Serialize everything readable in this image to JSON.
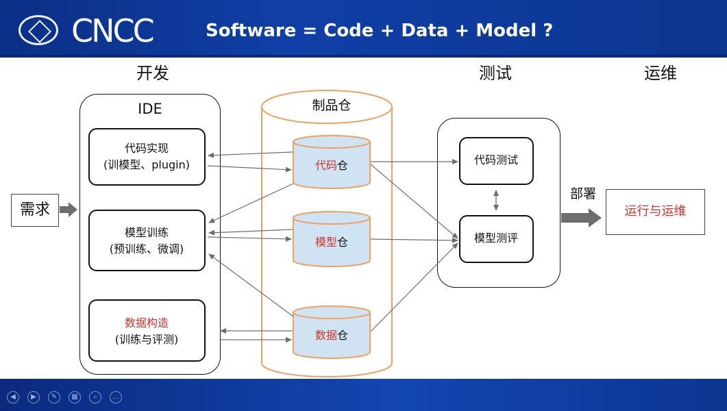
{
  "header": {
    "logo_text": "CNCC",
    "title": "Software = Code + Data + Model ?"
  },
  "stages": {
    "dev": "开发",
    "test": "测试",
    "ops": "运维"
  },
  "ide": {
    "title": "IDE",
    "code_impl": {
      "line1": "代码实现",
      "line2": "(训模型、plugin)"
    },
    "model_train": {
      "line1": "模型训练",
      "line2": "(预训练、微调)"
    },
    "data_build": {
      "line1": "数据构造",
      "line2": "(训练与评测)"
    }
  },
  "repo": {
    "title": "制品仓",
    "code": {
      "highlight": "代码",
      "suffix": "仓"
    },
    "model": {
      "highlight": "模型",
      "suffix": "仓"
    },
    "data": {
      "highlight": "数据",
      "suffix": "仓"
    }
  },
  "testing": {
    "code_test": "代码测试",
    "model_eval": "模型测评"
  },
  "requirement": "需求",
  "deploy": {
    "label": "部署",
    "target": "运行与运维"
  },
  "colors": {
    "header_blue": "#0f3fa6",
    "accent_red": "#d0342c",
    "repo_orange": "#f0a060",
    "cylinder_fill": "#cfe3f2",
    "arrow_gray": "#6e6e6e"
  },
  "footer_controls": [
    "prev-icon",
    "next-icon",
    "pen-icon",
    "slides-icon",
    "zoom-icon",
    "more-icon"
  ]
}
